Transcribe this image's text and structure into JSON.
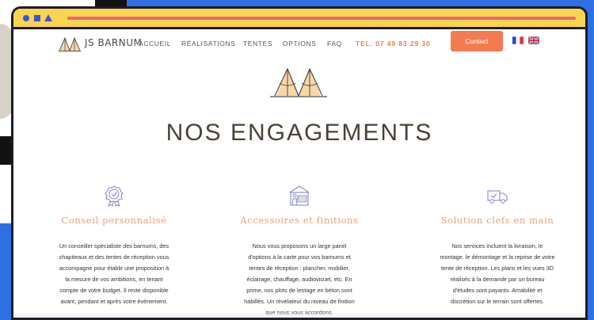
{
  "brand": {
    "name": "JS BARNUM"
  },
  "nav": {
    "items": [
      "ACCUEIL",
      "RÉALISATIONS",
      "TENTES",
      "OPTIONS",
      "FAQ"
    ],
    "phone": "TEL. 07 49 83 29 30",
    "contact": "Contact",
    "languages": [
      "fr-flag-icon",
      "uk-flag-icon"
    ]
  },
  "section": {
    "title": "NOS ENGAGEMENTS"
  },
  "features": [
    {
      "icon": "badge-check-icon",
      "title": "Conseil personnalisé",
      "lines": [
        "Un conseiller spécialiste des barnums, des",
        "chapiteaux et des tentes de réception vous",
        "accompagne pour établir une proposition à",
        "la mesure de vos ambitions, en tenant",
        "compte de votre budget. Il reste disponible",
        "avant, pendant et après votre évènement."
      ]
    },
    {
      "icon": "tent-workshop-icon",
      "title": "Accessoires et finitions",
      "lines": [
        "Nous vous proposons un large panel",
        "d'options à la carte pour vos barnums et",
        "tentes de réception : plancher, mobilier,",
        "éclairage, chauffage, audiovisuel, etc. En",
        "prime, nos plots de lestage en béton sont",
        "habillés. Un révélateur du niveau de finition",
        "que nous vous accordons."
      ]
    },
    {
      "icon": "delivery-truck-icon",
      "title": "Solution clefs en main",
      "lines": [
        "Nos services incluent la livraison, le",
        "montage, le démontage et la reprise de votre",
        "tente de réception. Les plans et les vues 3D",
        "réalisés à la demande par un bureau",
        "d'études sont payants. Amabilité et",
        "discrétion sur le terrain sont offertes."
      ]
    }
  ],
  "colors": {
    "titlebar": "#f9d44e",
    "accent": "#f47b50",
    "feature_title": "#e3a27b",
    "icon_stroke": "#8b87c9",
    "backdrop": "#2f6fe4"
  }
}
